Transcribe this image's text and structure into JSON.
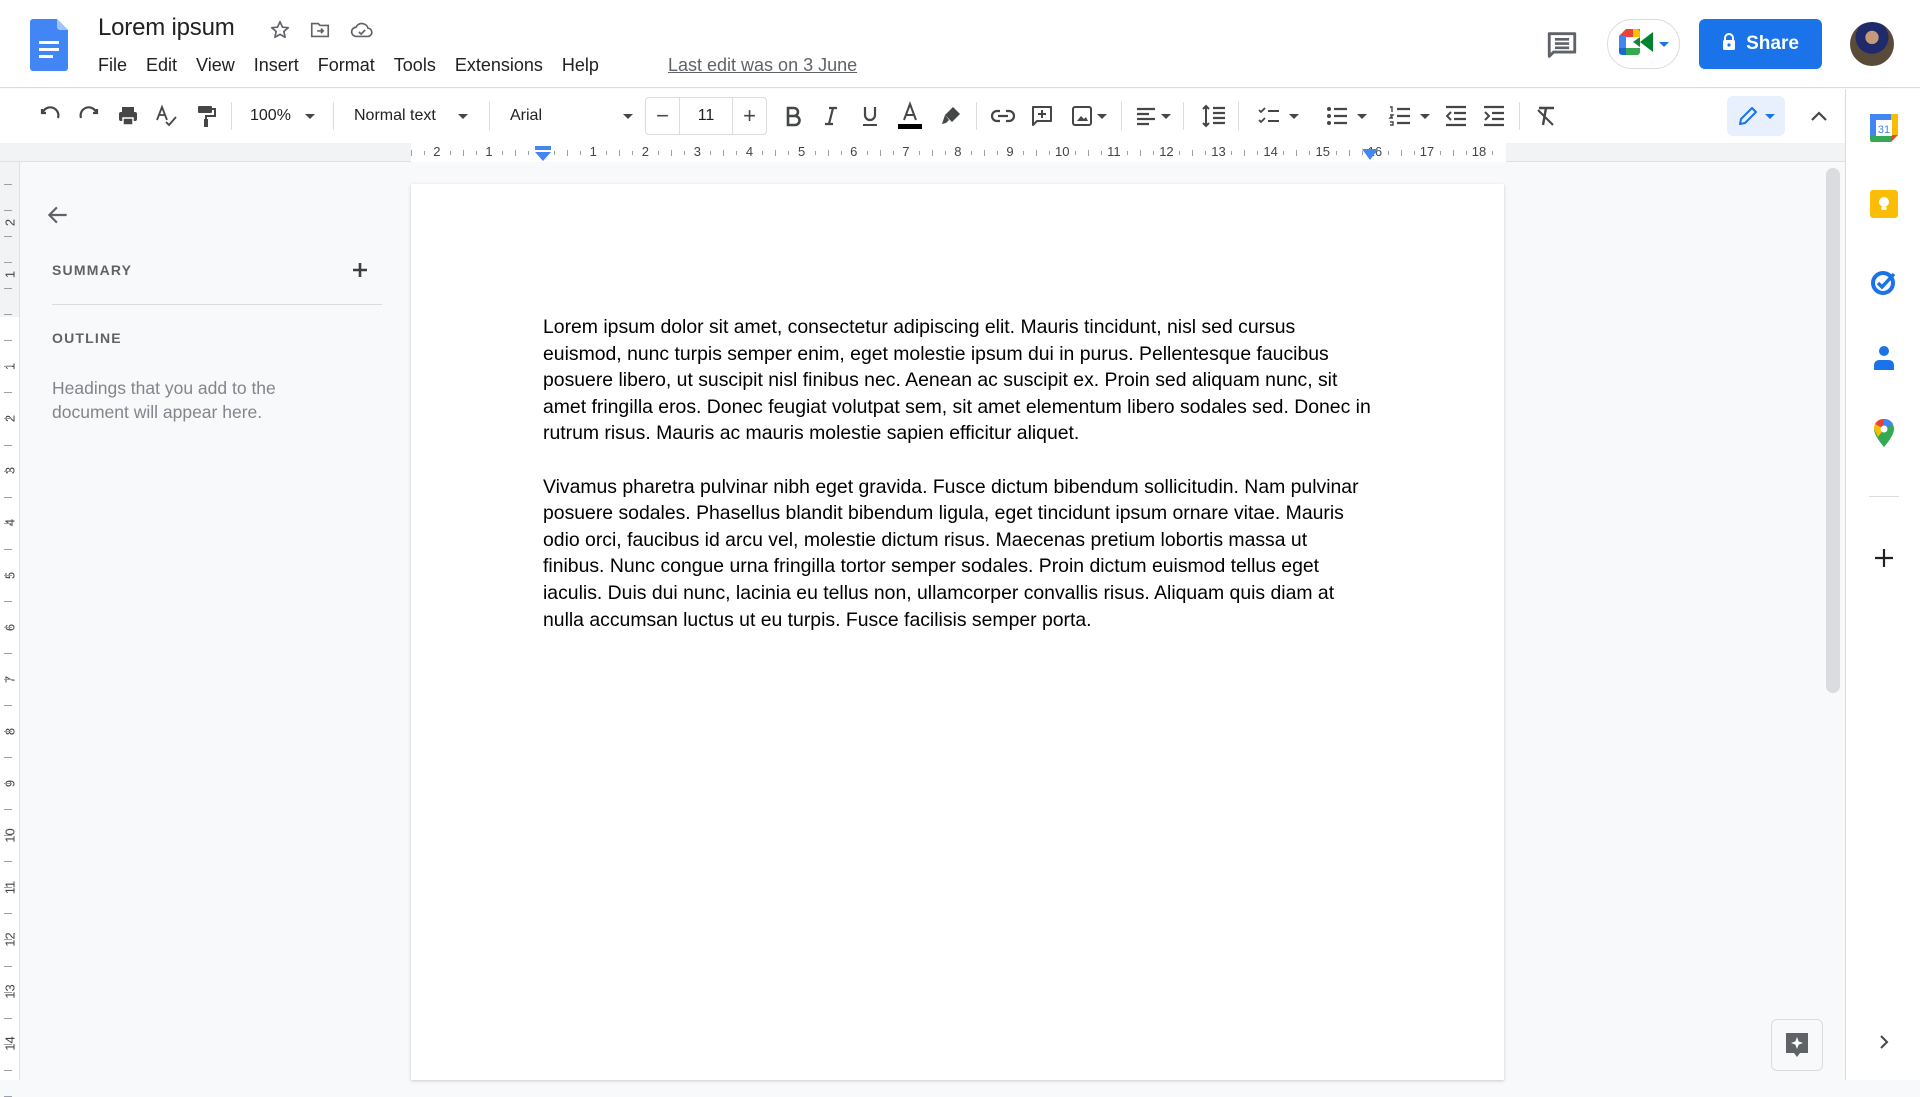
{
  "app": {
    "name": "Google Docs",
    "document_title": "Lorem ipsum",
    "last_edit": "Last edit was on 3 June"
  },
  "header": {
    "title_icons": [
      "star-icon",
      "move-to-folder-icon",
      "cloud-saved-icon"
    ],
    "menu": [
      "File",
      "Edit",
      "View",
      "Insert",
      "Format",
      "Tools",
      "Extensions",
      "Help"
    ],
    "share_label": "Share",
    "share_color": "#1a73e8"
  },
  "toolbar": {
    "zoom": "100%",
    "style": "Normal text",
    "font": "Arial",
    "font_size": "11",
    "minus": "−",
    "plus": "+"
  },
  "ruler": {
    "horizontal": [
      "2",
      "1",
      "1",
      "2",
      "3",
      "4",
      "5",
      "6",
      "7",
      "8",
      "9",
      "10",
      "11",
      "12",
      "13",
      "14",
      "15",
      "16",
      "17",
      "18"
    ],
    "vertical": [
      "2",
      "1",
      "1",
      "2",
      "3",
      "4",
      "5",
      "6",
      "7",
      "8",
      "9",
      "10",
      "11",
      "12",
      "13",
      "14"
    ]
  },
  "outline_panel": {
    "summary_label": "SUMMARY",
    "outline_label": "OUTLINE",
    "hint": "Headings that you add to the document will appear here."
  },
  "document": {
    "paragraphs": [
      "Lorem ipsum dolor sit amet, consectetur adipiscing elit. Mauris tincidunt, nisl sed cursus euismod, nunc turpis semper enim, eget molestie ipsum dui in purus. Pellentesque faucibus posuere libero, ut suscipit nisl finibus nec. Aenean ac suscipit ex. Proin sed aliquam nunc, sit amet fringilla eros. Donec feugiat volutpat sem, sit amet elementum libero sodales sed. Donec in rutrum risus. Mauris ac mauris molestie sapien efficitur aliquet.",
      "Vivamus pharetra pulvinar nibh eget gravida. Fusce dictum bibendum sollicitudin. Nam pulvinar posuere sodales. Phasellus blandit bibendum ligula, eget tincidunt ipsum ornare vitae. Mauris odio orci, faucibus id arcu vel, molestie dictum risus. Maecenas pretium lobortis massa ut finibus. Nunc congue urna fringilla tortor semper sodales. Proin dictum euismod tellus eget iaculis. Duis dui nunc, lacinia eu tellus non, ullamcorper convallis risus. Aliquam quis diam at nulla accumsan luctus ut eu turpis. Fusce facilisis semper porta."
    ]
  },
  "side_panel": {
    "calendar_day": "31",
    "apps": [
      "calendar-icon",
      "keep-icon",
      "tasks-icon",
      "contacts-icon",
      "maps-icon"
    ]
  }
}
